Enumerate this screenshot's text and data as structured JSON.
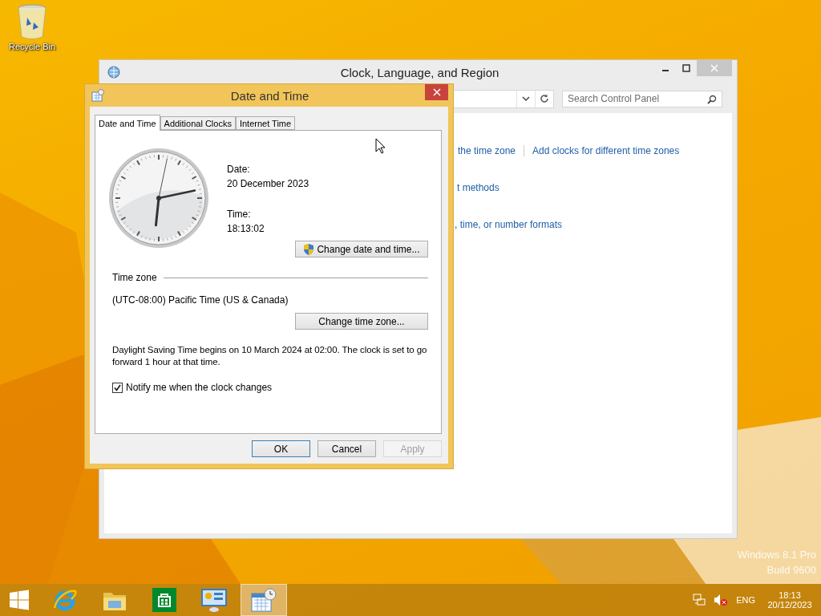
{
  "desktop": {
    "icons": [
      {
        "label": "Recycle Bin",
        "kind": "recycle_bin"
      }
    ],
    "watermark": [
      "Windows 8.1 Pro",
      "Build 9600"
    ]
  },
  "control_panel": {
    "title": "Clock, Language, and Region",
    "search": {
      "placeholder": "Search Control Panel"
    },
    "link_rows": [
      {
        "links": [
          "the time zone",
          "Add clocks for different time zones"
        ]
      },
      {
        "links": [
          "t methods"
        ]
      },
      {
        "links": [
          ", time, or number formats"
        ]
      }
    ]
  },
  "dialog": {
    "title": "Date and Time",
    "tabs": [
      {
        "label": "Date and Time",
        "selected": true
      },
      {
        "label": "Additional Clocks",
        "selected": false
      },
      {
        "label": "Internet Time",
        "selected": false
      }
    ],
    "date_label": "Date:",
    "date": "20 December 2023",
    "time_label": "Time:",
    "time": "18:13:02",
    "change_datetime_button": "Change date and time...",
    "time_zone_heading": "Time zone",
    "time_zone": "(UTC-08:00) Pacific Time (US & Canada)",
    "change_time_zone_button": "Change time zone...",
    "dst_note": "Daylight Saving Time begins on 10 March 2024 at 02:00. The clock is set to go forward 1 hour at that time.",
    "notify": {
      "label": "Notify me when the clock changes",
      "checked": true
    },
    "buttons": [
      {
        "label": "OK",
        "default": true,
        "disabled": false
      },
      {
        "label": "Cancel",
        "default": false,
        "disabled": false
      },
      {
        "label": "Apply",
        "default": false,
        "disabled": true
      }
    ]
  },
  "taskbar": {
    "apps": [
      {
        "kind": "start",
        "selected": false
      },
      {
        "kind": "browser",
        "selected": false
      },
      {
        "kind": "files",
        "selected": false
      },
      {
        "kind": "store",
        "selected": false
      },
      {
        "kind": "control_panel",
        "selected": false
      },
      {
        "kind": "date_time",
        "selected": true
      }
    ],
    "language": "ENG",
    "clock": {
      "time": "18:13",
      "date": "20/12/2023"
    }
  }
}
